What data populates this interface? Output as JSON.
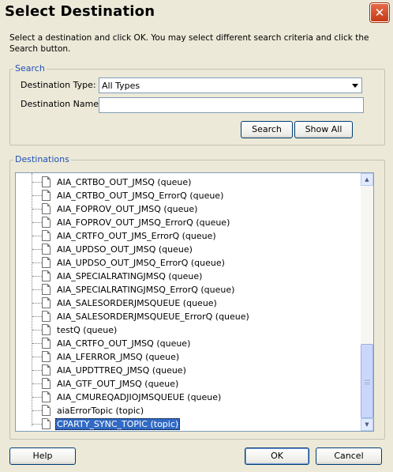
{
  "window": {
    "title": "Select Destination"
  },
  "instructions": "Select a destination and click OK. You may select different search criteria and click the Search button.",
  "search": {
    "group_label": "Search",
    "type_label": "Destination Type:",
    "type_value": "All Types",
    "name_label": "Destination Name:",
    "name_value": "",
    "search_button": "Search",
    "show_all_button": "Show All"
  },
  "destinations": {
    "group_label": "Destinations",
    "items": [
      "AIA_CRTBO_OUT_JMSQ (queue)",
      "AIA_CRTBO_OUT_JMSQ_ErrorQ (queue)",
      "AIA_FOPROV_OUT_JMSQ (queue)",
      "AIA_FOPROV_OUT_JMSQ_ErrorQ (queue)",
      "AIA_CRTFO_OUT_JMS_ErrorQ (queue)",
      "AIA_UPDSO_OUT_JMSQ (queue)",
      "AIA_UPDSO_OUT_JMSQ_ErrorQ (queue)",
      "AIA_SPECIALRATINGJMSQ (queue)",
      "AIA_SPECIALRATINGJMSQ_ErrorQ (queue)",
      "AIA_SALESORDERJMSQUEUE (queue)",
      "AIA_SALESORDERJMSQUEUE_ErrorQ (queue)",
      "testQ (queue)",
      "AIA_CRTFO_OUT_JMSQ (queue)",
      "AIA_LFERROR_JMSQ (queue)",
      "AIA_UPDTTREQ_JMSQ (queue)",
      "AIA_GTF_OUT_JMSQ (queue)",
      "AIA_CMUREQADJIOJMSQUEUE (queue)",
      "aiaErrorTopic (topic)",
      "CPARTY_SYNC_TOPIC (topic)"
    ],
    "selected_index": 18
  },
  "buttons": {
    "help": "Help",
    "ok": "OK",
    "cancel": "Cancel"
  }
}
